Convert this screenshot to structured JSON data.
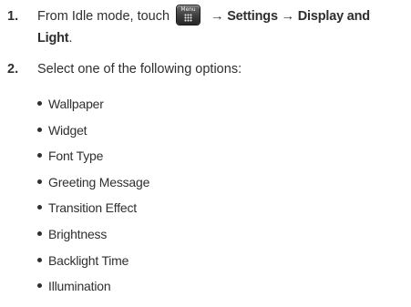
{
  "step1": {
    "number": "1.",
    "prefix": "From Idle mode, touch",
    "menu_icon_caption": "Menu",
    "menu_icon": "menu-grid-icon",
    "path_text": "→ Settings → Display and",
    "path_text_line2": "Light",
    "suffix": "."
  },
  "step2": {
    "number": "2.",
    "text": "Select one of the following options:"
  },
  "options": [
    "Wallpaper",
    "Widget",
    "Font Type",
    "Greeting Message",
    "Transition Effect",
    "Brightness",
    "Backlight Time",
    "Illumination"
  ]
}
